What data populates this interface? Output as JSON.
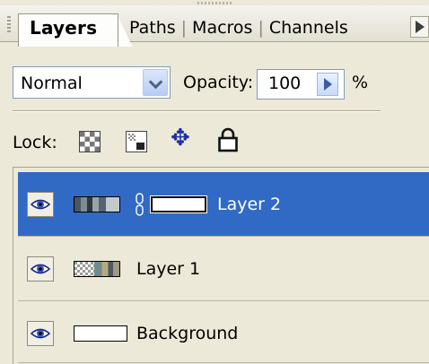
{
  "tabs": {
    "active": "Layers",
    "others": [
      "Paths",
      "Macros",
      "Channels"
    ]
  },
  "blend": {
    "mode": "Normal"
  },
  "opacity": {
    "label": "Opacity:",
    "value": "100",
    "unit": "%"
  },
  "lock": {
    "label": "Lock:"
  },
  "layers": [
    {
      "name": "Layer 2",
      "selected": true,
      "has_mask": true
    },
    {
      "name": "Layer 1",
      "selected": false,
      "has_mask": false
    },
    {
      "name": "Background",
      "selected": false,
      "has_mask": false
    }
  ],
  "colors": {
    "selection": "#316ac5",
    "panel": "#ece9d8"
  },
  "icons": {
    "lock_transparency": "checkerboard-icon",
    "lock_pixels": "lock-pixels-icon",
    "lock_position": "move-arrows-icon",
    "lock_all": "padlock-icon",
    "visibility": "eye-icon",
    "link": "chain-link-icon"
  }
}
